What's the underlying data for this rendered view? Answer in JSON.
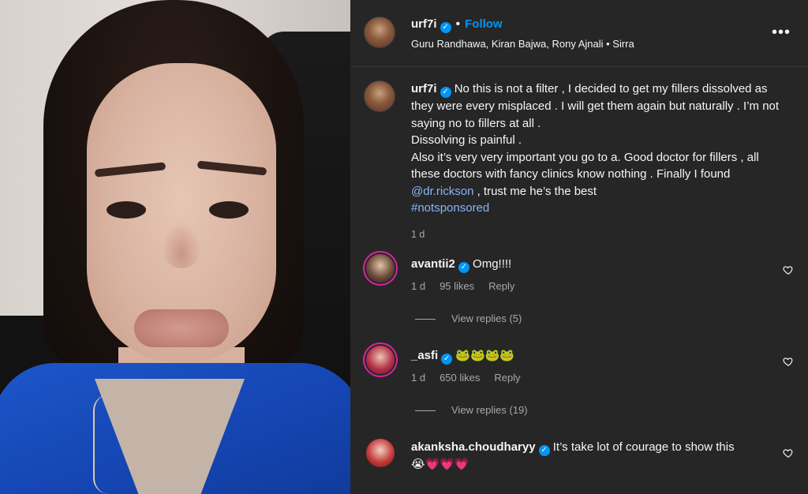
{
  "post": {
    "username": "urf7i",
    "follow_label": "Follow",
    "audio": "Guru Randhawa, Kiran Bajwa, Rony Ajnali • Sirra",
    "more_label": "•••"
  },
  "caption": {
    "username": "urf7i",
    "line1": "No this is not a filter , I decided to get my fillers dissolved as they were every misplaced . I will get them again but naturally . I’m not saying no to fillers at all .",
    "line2": "Dissolving is painful .",
    "line3a": "Also it’s very very important you go to a. Good doctor for fillers , all these doctors with fancy clinics know nothing . Finally I found ",
    "mention": "@dr.rickson",
    "line3b": " , trust me he’s the best",
    "hashtag": "#notsponsored",
    "time": "1 d"
  },
  "comments": [
    {
      "username": "avantii2",
      "text": "Omg!!!!",
      "time": "1 d",
      "likes": "95 likes",
      "reply": "Reply",
      "view_replies": "View replies (5)"
    },
    {
      "username": "_asfi",
      "text": "🐸🐸🐸🐸",
      "time": "1 d",
      "likes": "650 likes",
      "reply": "Reply",
      "view_replies": "View replies (19)"
    },
    {
      "username": "akanksha.choudharyy",
      "text": "It’s take lot of courage to show this",
      "text2": "😭💗💗💗"
    }
  ],
  "colors": {
    "panel_bg": "#262626",
    "link": "#8ab4f8",
    "verified": "#0095f6",
    "muted": "#a8a8a8"
  },
  "icons": [
    "verified-badge-icon",
    "more-options-icon",
    "heart-icon"
  ]
}
